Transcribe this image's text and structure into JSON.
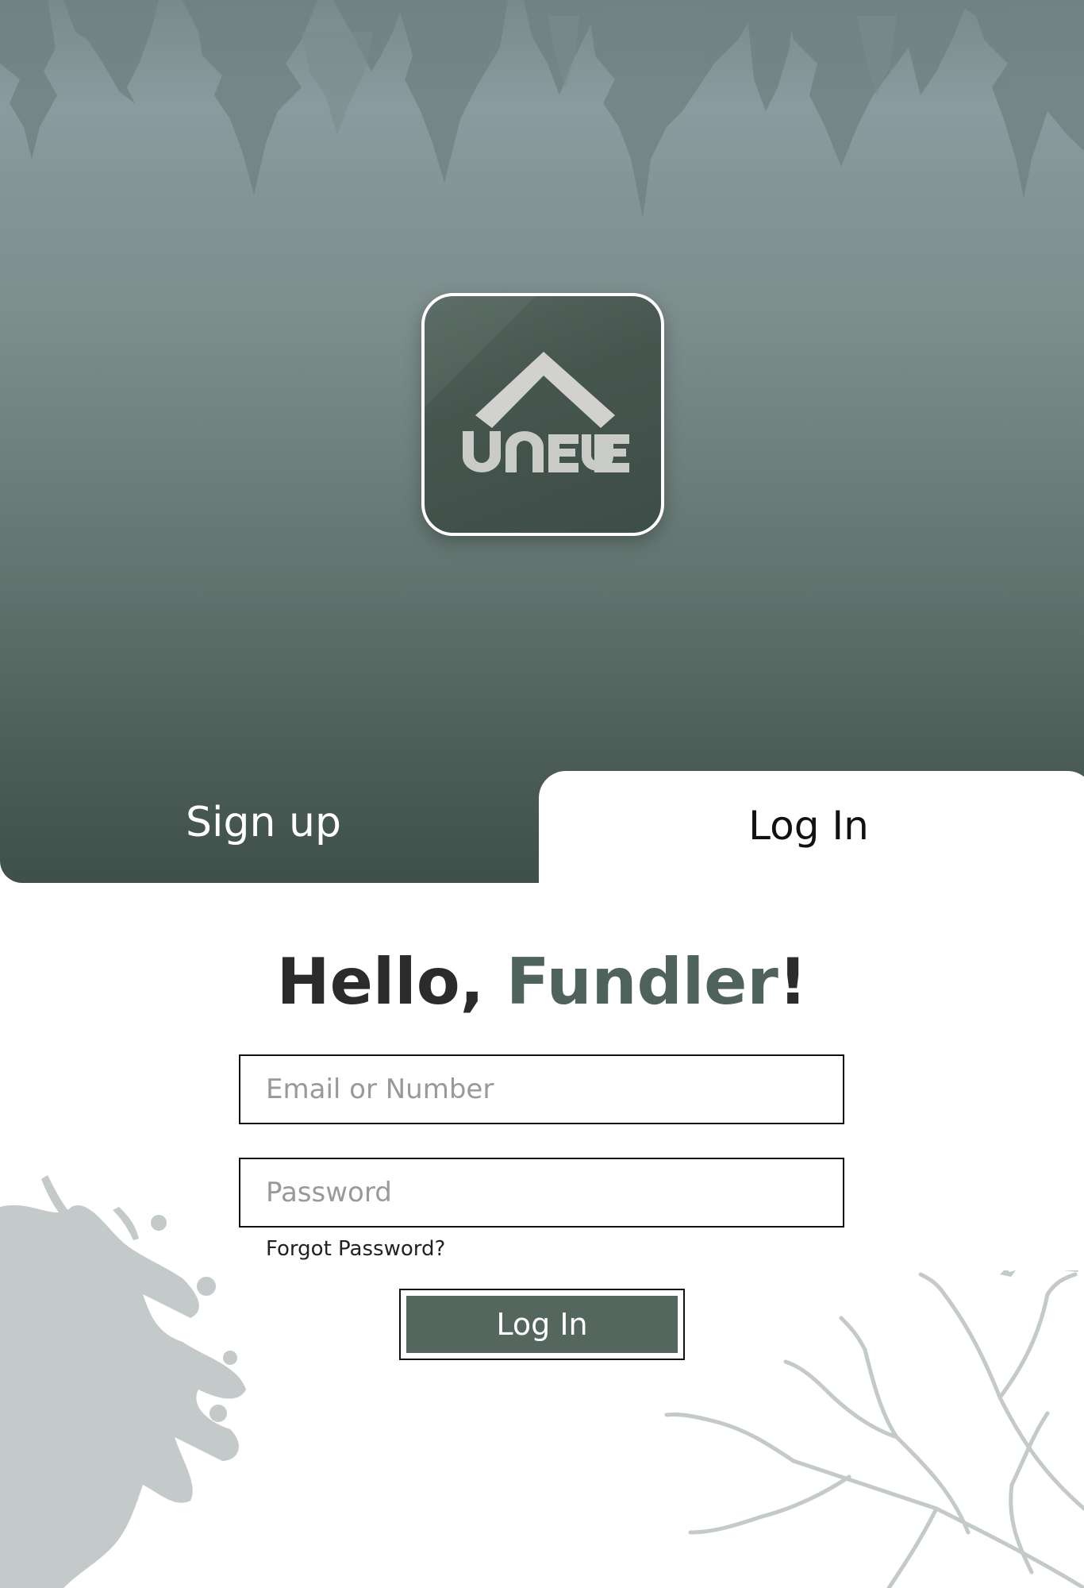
{
  "brand": {
    "logo_text": "UNFUE"
  },
  "tabs": {
    "signup_label": "Sign up",
    "login_label": "Log In",
    "active": "login"
  },
  "login_form": {
    "greeting_prefix": "Hello, ",
    "greeting_name": "Fundler",
    "greeting_suffix": "!",
    "email_placeholder": "Email or Number",
    "password_placeholder": "Password",
    "forgot_password": "Forgot Password?",
    "submit_label": "Log In"
  },
  "colors": {
    "accent": "#4f625c",
    "button": "#55665f",
    "hero_top": "#8a9a9e",
    "hero_bottom": "#3f4f4a",
    "tree_silhouette": "#c4c9c9"
  },
  "icons": {
    "logo": "house-roof-logo-icon"
  }
}
